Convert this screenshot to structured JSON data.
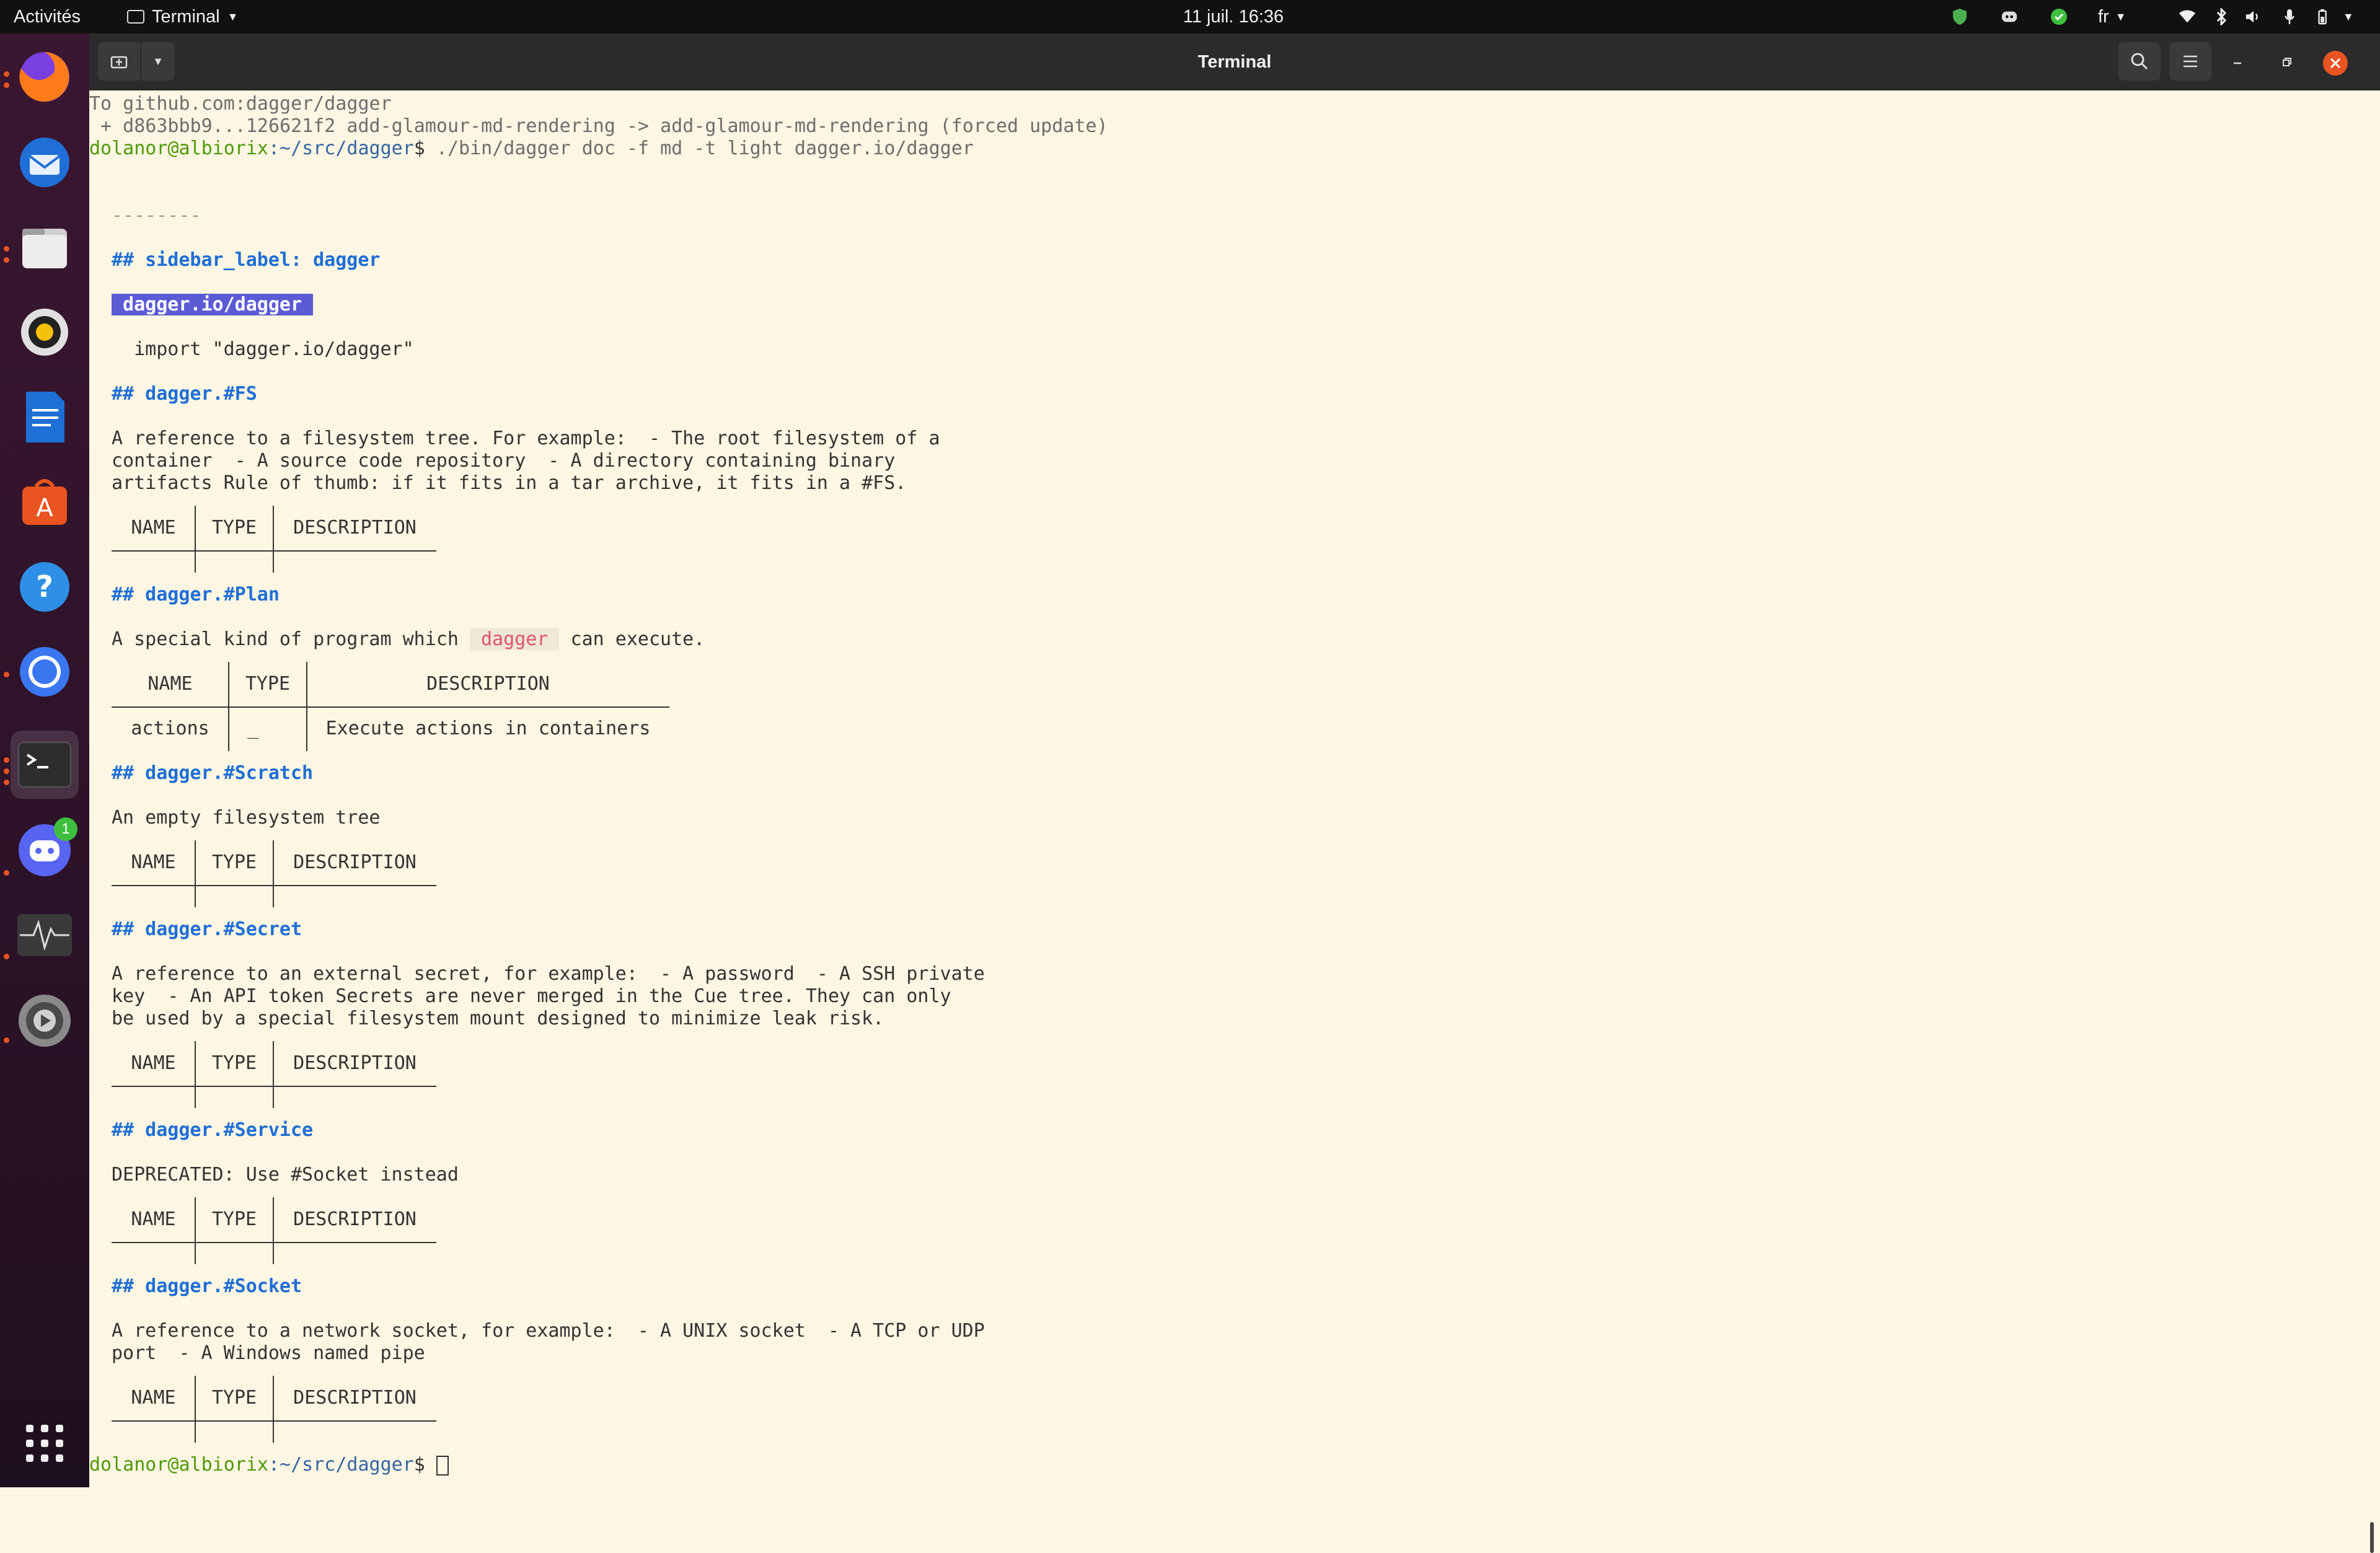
{
  "topbar": {
    "activities": "Activités",
    "app_menu": "Terminal",
    "clock": "11 juil.  16:36",
    "keyboard_layout": "fr"
  },
  "dock": {
    "apps": [
      "firefox-icon",
      "thunderbird-icon",
      "files-icon",
      "rhythmbox-icon",
      "writer-icon",
      "app-center-icon",
      "help-icon",
      "signal-icon",
      "terminal-icon",
      "discord-icon",
      "system-monitor-icon",
      "settings-icon"
    ],
    "discord_badge": "1"
  },
  "window": {
    "title": "Terminal"
  },
  "terminal": {
    "line_push_to": "To github.com:dagger/dagger",
    "line_push_update": " + d863bbb9...126621f2 add-glamour-md-rendering -> add-glamour-md-rendering (forced update)",
    "prompt_user": "dolanor@albiorix",
    "prompt_path": ":~/src/dagger",
    "prompt_dollar": "$ ",
    "command": "./bin/dagger doc -f md -t light dagger.io/dagger",
    "hr": "--------",
    "sidebar_heading": "## sidebar_label: dagger",
    "package_badge": " dagger.io/dagger ",
    "import_line": "  import \"dagger.io/dagger\"",
    "fs_heading": "## dagger.#FS",
    "fs_desc": [
      "A reference to a filesystem tree. For example:  - The root filesystem of a",
      "container  - A source code repository  - A directory containing binary",
      "artifacts Rule of thumb: if it fits in a tar archive, it fits in a #FS."
    ],
    "col_name": "NAME",
    "col_type": "TYPE",
    "col_description": "DESCRIPTION",
    "plan_heading": "## dagger.#Plan",
    "plan_desc_pre": "A special kind of program which ",
    "plan_desc_code": " dagger ",
    "plan_desc_post": " can execute.",
    "plan_row": {
      "name": "actions",
      "type": "_",
      "description": "Execute actions in containers"
    },
    "scratch_heading": "## dagger.#Scratch",
    "scratch_desc": "An empty filesystem tree",
    "secret_heading": "## dagger.#Secret",
    "secret_desc": [
      "A reference to an external secret, for example:  - A password  - A SSH private",
      "key  - An API token Secrets are never merged in the Cue tree. They can only",
      "be used by a special filesystem mount designed to minimize leak risk."
    ],
    "service_heading": "## dagger.#Service",
    "service_desc": "DEPRECATED: Use #Socket instead",
    "socket_heading": "## dagger.#Socket",
    "socket_desc": [
      "A reference to a network socket, for example:  - A UNIX socket  - A TCP or UDP",
      "port  - A Windows named pipe"
    ]
  },
  "colors": {
    "terminal_bg": "#fdf6e3",
    "heading": "#1f6fd6",
    "badge_bg": "#5b5bd6",
    "code_fg": "#e0546b",
    "close_button": "#e95420"
  }
}
